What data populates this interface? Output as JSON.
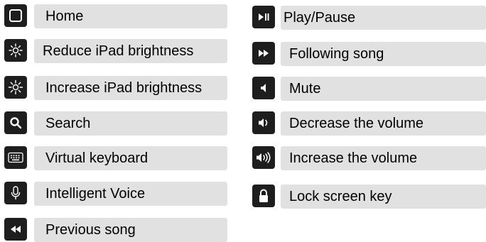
{
  "colors": {
    "icon_bg": "#1e1e1e",
    "label_bg": "#e1e1e1",
    "text": "#000000"
  },
  "left_keys": [
    {
      "label": "Home",
      "icon": "home-square-icon"
    },
    {
      "label": "Reduce iPad brightness",
      "icon": "brightness-down-icon"
    },
    {
      "label": "Increase iPad brightness",
      "icon": "brightness-up-icon"
    },
    {
      "label": "Search",
      "icon": "search-icon"
    },
    {
      "label": "Virtual keyboard",
      "icon": "keyboard-icon"
    },
    {
      "label": "Intelligent Voice",
      "icon": "microphone-icon"
    },
    {
      "label": "Previous song",
      "icon": "rewind-icon"
    }
  ],
  "right_keys": [
    {
      "label": "Play/Pause",
      "icon": "play-pause-icon"
    },
    {
      "label": "Following song",
      "icon": "fast-forward-icon"
    },
    {
      "label": "Mute",
      "icon": "mute-icon"
    },
    {
      "label": "Decrease the volume",
      "icon": "volume-down-icon"
    },
    {
      "label": "Increase the volume",
      "icon": "volume-up-icon"
    },
    {
      "label": "Lock screen key",
      "icon": "lock-icon"
    }
  ]
}
